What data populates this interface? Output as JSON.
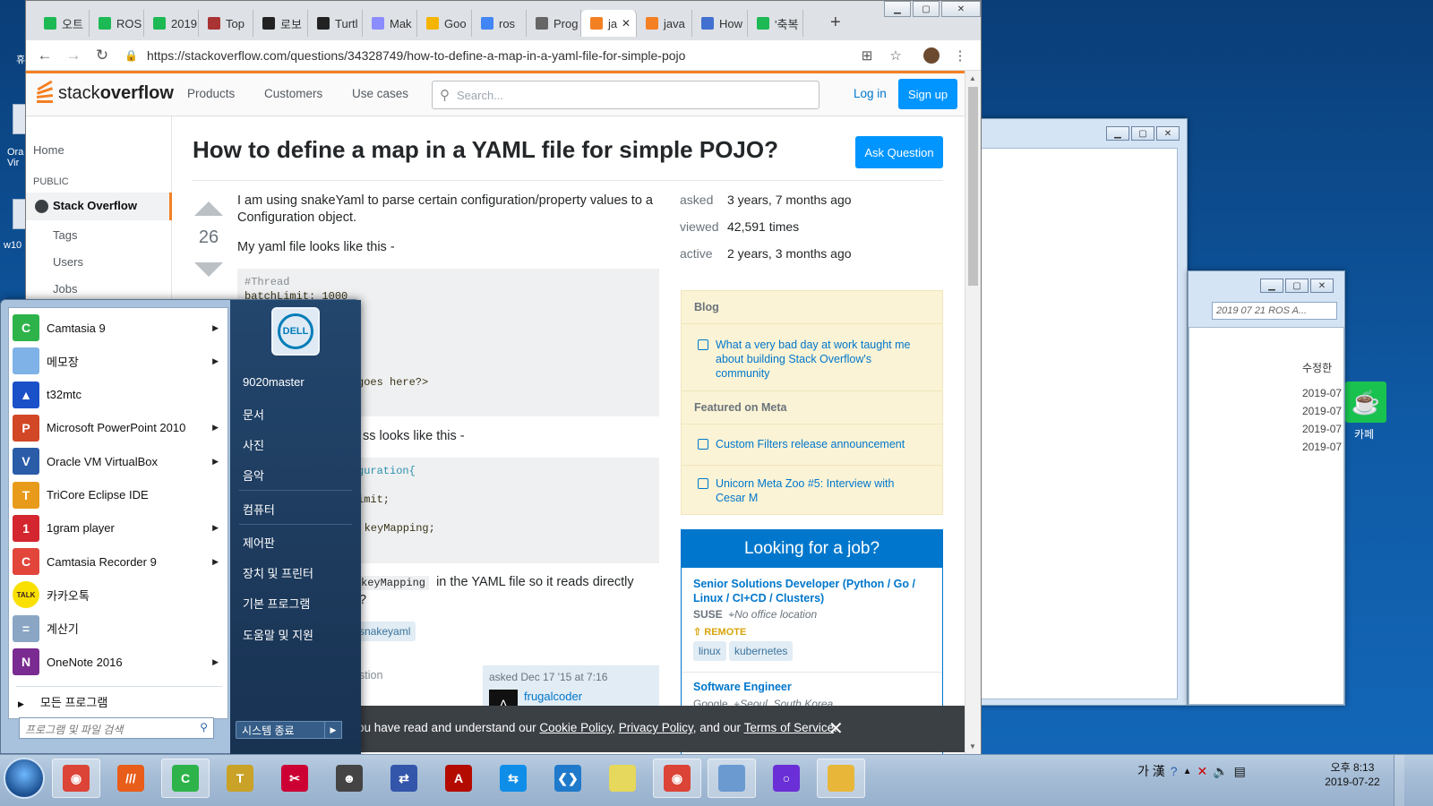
{
  "desktop": {
    "icons": [
      {
        "label": "휴"
      },
      {
        "label": "Ora Vir"
      },
      {
        "label": "w10"
      }
    ],
    "cafe_label": "카페"
  },
  "explorer": {
    "search_placeholder": "2019 07 21 ROS A...",
    "column_header": "수정한",
    "dates": [
      "2019-07",
      "2019-07",
      "2019-07",
      "2019-07"
    ]
  },
  "browser": {
    "tabs": [
      {
        "title": "오트",
        "color": "#1db954"
      },
      {
        "title": "ROS",
        "color": "#1db954"
      },
      {
        "title": "2019",
        "color": "#1db954"
      },
      {
        "title": "Top",
        "color": "#a33"
      },
      {
        "title": "로보",
        "color": "#222"
      },
      {
        "title": "Turtl",
        "color": "#222"
      },
      {
        "title": "Mak",
        "color": "#8a8cff"
      },
      {
        "title": "Goo",
        "color": "#f4b400"
      },
      {
        "title": "ros",
        "color": "#4285f4"
      },
      {
        "title": "Prog",
        "color": "#666"
      },
      {
        "title": "ja",
        "color": "#f48024"
      },
      {
        "title": "java",
        "color": "#f48024"
      },
      {
        "title": "How",
        "color": "#4170d0"
      },
      {
        "title": "'축복",
        "color": "#1db954"
      }
    ],
    "url": "https://stackoverflow.com/questions/34328749/how-to-define-a-map-in-a-yaml-file-for-simple-pojo"
  },
  "so": {
    "logo_a": "stack",
    "logo_b": "overflow",
    "nav": [
      "Products",
      "Customers",
      "Use cases"
    ],
    "search_placeholder": "Search...",
    "login": "Log in",
    "signup": "Sign up",
    "left_nav": {
      "home": "Home",
      "public": "PUBLIC",
      "stack_overflow": "Stack Overflow",
      "tags": "Tags",
      "users": "Users",
      "jobs": "Jobs"
    },
    "question": {
      "title": "How to define a map in a YAML file for simple POJO?",
      "ask_button": "Ask Question",
      "votes": "26",
      "p1": "I am using snakeYaml to parse certain configuration/property values to a Configuration object.",
      "p2": "My yaml file looks like this -",
      "code1": [
        "#Thread",
        "batchLimit: 1000",
        "",
        "",
        "",
        "",
        "",
        "goes here?>"
      ],
      "p3": "ss looks like this -",
      "code2": [
        "guration{",
        "",
        "imit;",
        "",
        "g> keyMapping;"
      ],
      "p4_code": "keyMapping",
      "p4_text": "in the YAML file so it reads directly",
      "p4_end": "?",
      "tag": "snakeyaml",
      "share_text": "stion",
      "asked_text": "asked Dec 17 '15 at 7:16",
      "user": "frugalcoder"
    },
    "stats": [
      {
        "k": "asked",
        "v": "3 years, 7 months ago"
      },
      {
        "k": "viewed",
        "v": "42,591 times"
      },
      {
        "k": "active",
        "v": "2 years, 3 months ago"
      }
    ],
    "sidebar": {
      "blog_h": "Blog",
      "blog_item": "What a very bad day at work taught me about building Stack Overflow's community",
      "meta_h": "Featured on Meta",
      "meta_1": "Custom Filters release announcement",
      "meta_2": "Unicorn Meta Zoo #5: Interview with Cesar M"
    },
    "jobs": {
      "header": "Looking for a job?",
      "job1_title": "Senior Solutions Developer (Python / Go / Linux / CI+CD / Clusters)",
      "job1_company": "SUSE",
      "job1_location": "No office location",
      "job1_remote": "REMOTE",
      "job1_tags": [
        "linux",
        "kubernetes"
      ],
      "job2_title": "Software Engineer",
      "job2_company": "Google",
      "job2_location": "Seoul, South Korea"
    },
    "cookie": {
      "pre": "ou have read and understand our ",
      "l1": "Cookie Policy",
      ",": ",",
      "l2": "Privacy Policy",
      "mid": ", and our ",
      "l3": "Terms of Service",
      "end": "."
    }
  },
  "startmenu": {
    "items": [
      {
        "label": "Camtasia 9",
        "color": "#2db34a",
        "g": "C",
        "arrow": true
      },
      {
        "label": "메모장",
        "color": "#7fb2e6",
        "g": "",
        "arrow": true
      },
      {
        "label": "t32mtc",
        "color": "#1a50c8",
        "g": "▲",
        "arrow": false
      },
      {
        "label": "Microsoft PowerPoint 2010",
        "color": "#d24726",
        "g": "P",
        "arrow": true
      },
      {
        "label": "Oracle VM VirtualBox",
        "color": "#2a5ca8",
        "g": "V",
        "arrow": true
      },
      {
        "label": "TriCore Eclipse IDE",
        "color": "#e89b1a",
        "g": "T",
        "arrow": false
      },
      {
        "label": "1gram player",
        "color": "#d3262e",
        "g": "1",
        "arrow": true
      },
      {
        "label": "Camtasia Recorder 9",
        "color": "#e2463b",
        "g": "C",
        "arrow": true
      },
      {
        "label": "카카오톡",
        "color": "#f9e000",
        "g": "TALK",
        "arrow": false
      },
      {
        "label": "계산기",
        "color": "#8aa6c4",
        "g": "=",
        "arrow": false
      },
      {
        "label": "OneNote 2016",
        "color": "#7a2b91",
        "g": "N",
        "arrow": true
      }
    ],
    "all_programs": "모든 프로그램",
    "search_placeholder": "프로그램 및 파일 검색",
    "dell": "DELL",
    "right_items": [
      "9020master",
      "문서",
      "사진",
      "음악",
      "컴퓨터",
      "제어판",
      "장치 및 프린터",
      "기본 프로그램",
      "도움말 및 지원"
    ],
    "shutdown": "시스템 종료"
  },
  "taskbar": {
    "apps": [
      {
        "name": "chrome",
        "color": "#db4437",
        "g": "◉"
      },
      {
        "name": "app-stripes",
        "color": "#e85d1a",
        "g": "///"
      },
      {
        "name": "camtasia",
        "color": "#2db34a",
        "g": "C"
      },
      {
        "name": "tool",
        "color": "#c9a227",
        "g": "T"
      },
      {
        "name": "snip",
        "color": "#c03",
        "g": "✂"
      },
      {
        "name": "alien",
        "color": "#444",
        "g": "☻"
      },
      {
        "name": "network",
        "color": "#3355aa",
        "g": "⇄"
      },
      {
        "name": "acrobat",
        "color": "#b30b00",
        "g": "A"
      },
      {
        "name": "teamviewer",
        "color": "#0e8ee9",
        "g": "⇆"
      },
      {
        "name": "vscode",
        "color": "#1f7acc",
        "g": "❮❯"
      },
      {
        "name": "sticky",
        "color": "#e5d85c",
        "g": ""
      },
      {
        "name": "chrome2",
        "color": "#db4437",
        "g": "◉"
      },
      {
        "name": "notepad",
        "color": "#6b9ad1",
        "g": ""
      },
      {
        "name": "circle",
        "color": "#6a2fd6",
        "g": "○"
      },
      {
        "name": "explorer",
        "color": "#e8b73a",
        "g": ""
      }
    ],
    "ime": "가 漢",
    "clock_time": "오후 8:13",
    "clock_date": "2019-07-22"
  }
}
